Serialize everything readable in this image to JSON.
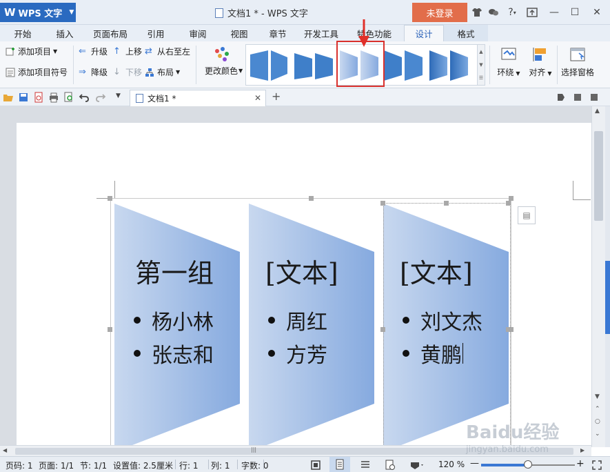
{
  "app": {
    "logo": "W",
    "name": "WPS 文字",
    "title": "文档1 * - WPS 文字",
    "login": "未登录"
  },
  "window_controls": {
    "min": "—",
    "max": "☐",
    "close": "✕",
    "help": "?"
  },
  "tabs": [
    "开始",
    "插入",
    "页面布局",
    "引用",
    "审阅",
    "视图",
    "章节",
    "开发工具",
    "特色功能",
    "设计",
    "格式"
  ],
  "ribbon": {
    "add_item": "添加项目",
    "add_bullet": "添加项目符号",
    "promote": "升级",
    "demote": "降级",
    "move_up": "上移",
    "move_down": "下移",
    "rtl": "从右至左",
    "layout": "布局",
    "change_color": "更改颜色",
    "wrap": "环绕",
    "align": "对齐",
    "selection_pane": "选择窗格"
  },
  "doc_tab": {
    "label": "文档1 *",
    "close": "✕",
    "new": "+"
  },
  "smartart": {
    "shapes": [
      {
        "title": "第一组",
        "items": [
          "杨小林",
          "张志和"
        ]
      },
      {
        "title": "[文本]",
        "items": [
          "周红",
          "方芳"
        ]
      },
      {
        "title": "[文本]",
        "items": [
          "刘文杰",
          "黄鹏"
        ]
      }
    ]
  },
  "status": {
    "page": "页码: 1",
    "pages": "页面: 1/1",
    "section": "节: 1/1",
    "setting": "设置值: 2.5厘米",
    "row": "行: 1",
    "col": "列: 1",
    "words": "字数: 0",
    "zoom": "120 %",
    "zoom_level": 0.5
  },
  "watermark": {
    "brand": "Baidu经验",
    "url": "jingyan.baidu.com"
  },
  "colors": {
    "accent": "#2a6ac0",
    "login": "#e26d4a",
    "highlight": "#d9302c",
    "shape_light": "#c8d8ef",
    "shape_dark": "#86aadf"
  }
}
